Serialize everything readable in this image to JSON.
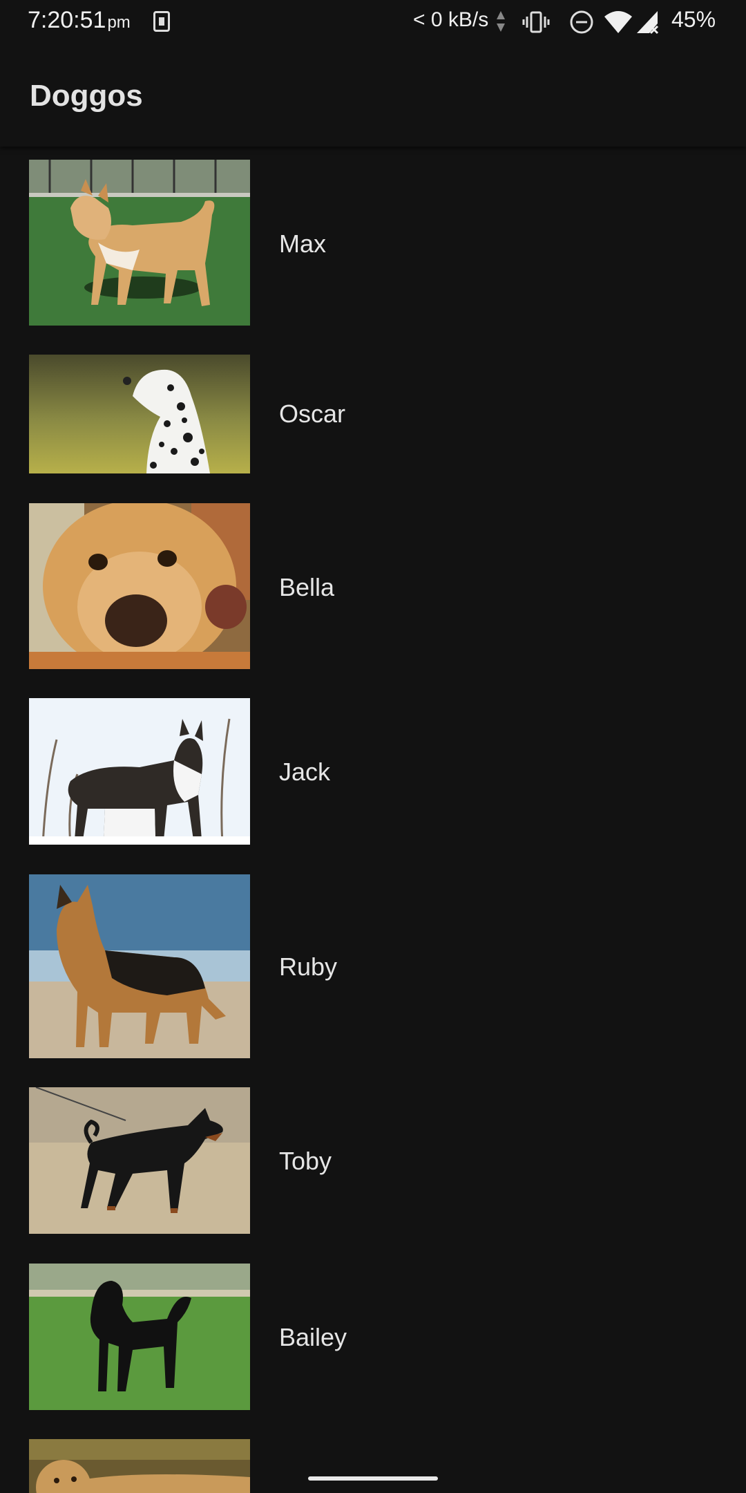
{
  "status_bar": {
    "time": "7:20:51",
    "ampm": "pm",
    "network_speed": "< 0 kB/s",
    "battery": "45%",
    "icons": [
      "notification-icon",
      "data-arrows-icon",
      "vibrate-icon",
      "do-not-disturb-icon",
      "wifi-icon",
      "signal-icon"
    ]
  },
  "app_bar": {
    "title": "Doggos"
  },
  "dogs": [
    {
      "name": "Max",
      "photo": "shiba-inu-photo"
    },
    {
      "name": "Oscar",
      "photo": "dalmatian-photo"
    },
    {
      "name": "Bella",
      "photo": "golden-retriever-photo"
    },
    {
      "name": "Jack",
      "photo": "husky-photo"
    },
    {
      "name": "Ruby",
      "photo": "german-shepherd-photo"
    },
    {
      "name": "Toby",
      "photo": "doberman-photo"
    },
    {
      "name": "Bailey",
      "photo": "poodle-photo"
    },
    {
      "name": "",
      "photo": "labrador-photo"
    }
  ]
}
